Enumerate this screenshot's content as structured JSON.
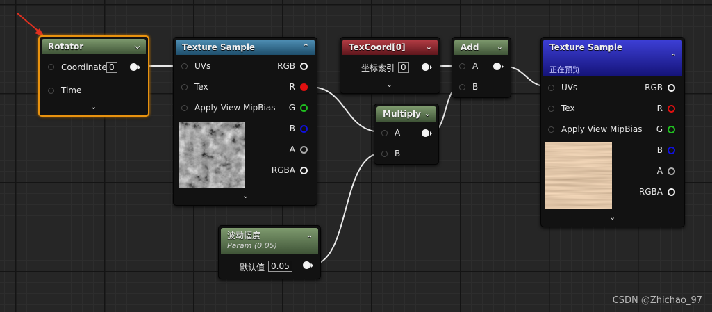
{
  "nodes": {
    "rotator": {
      "title": "Rotator",
      "pins": [
        "Coordinate",
        "Time"
      ],
      "coord_value": "0"
    },
    "tex1": {
      "title": "Texture Sample",
      "inputs": [
        "UVs",
        "Tex",
        "Apply View MipBias"
      ],
      "outputs": [
        "RGB",
        "R",
        "G",
        "B",
        "A",
        "RGBA"
      ]
    },
    "texcoord": {
      "title": "TexCoord[0]",
      "label": "坐标索引",
      "value": "0"
    },
    "add": {
      "title": "Add",
      "inputs": [
        "A",
        "B"
      ]
    },
    "multiply": {
      "title": "Multiply",
      "inputs": [
        "A",
        "B"
      ]
    },
    "param": {
      "title": "波动幅度",
      "subtitle": "Param (0.05)",
      "label": "默认值",
      "value": "0.05"
    },
    "tex2": {
      "title": "Texture Sample",
      "subtitle": "正在预览",
      "inputs": [
        "UVs",
        "Tex",
        "Apply View MipBias"
      ],
      "outputs": [
        "RGB",
        "R",
        "G",
        "B",
        "A",
        "RGBA"
      ]
    }
  },
  "watermark": "CSDN @Zhichao_97",
  "colors": {
    "selection": "#e8920f",
    "pin_r": "#e01010",
    "pin_g": "#20c020",
    "pin_b": "#1010e0",
    "wire": "#e8e8e8",
    "annotation_arrow": "#e03020"
  },
  "icons": {
    "collapse": "chevron-up-icon",
    "menu": "chevron-down-icon"
  }
}
